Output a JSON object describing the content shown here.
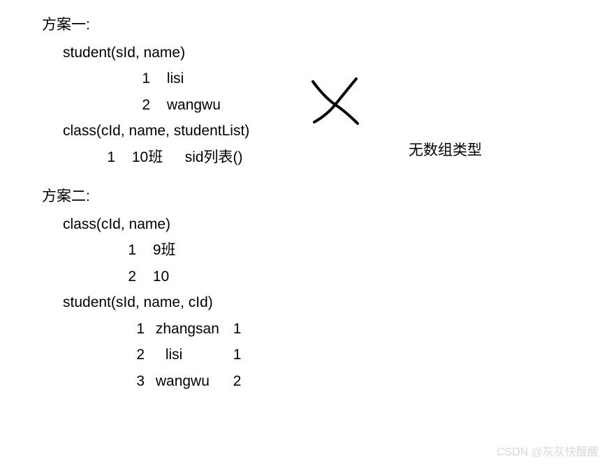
{
  "plan1": {
    "title": "方案一:",
    "student_schema": "student(sId, name)",
    "student_rows": [
      {
        "id": "1",
        "name": "lisi"
      },
      {
        "id": "2",
        "name": "wangwu"
      }
    ],
    "class_schema": "class(cId, name, studentList)",
    "class_row": {
      "id": "1",
      "name": "10班",
      "list": "sid列表()"
    },
    "note": "无数组类型"
  },
  "plan2": {
    "title": "方案二:",
    "class_schema": "class(cId, name)",
    "class_rows": [
      {
        "id": "1",
        "name": "9班"
      },
      {
        "id": "2",
        "name": "10"
      }
    ],
    "student_schema": "student(sId, name, cId)",
    "student_rows": [
      {
        "id": "1",
        "name": "zhangsan",
        "cid": "1"
      },
      {
        "id": "2",
        "name": "lisi",
        "cid": "1"
      },
      {
        "id": "3",
        "name": "wangwu",
        "cid": "2"
      }
    ]
  },
  "watermark": "CSDN @灰灰快醒醒"
}
